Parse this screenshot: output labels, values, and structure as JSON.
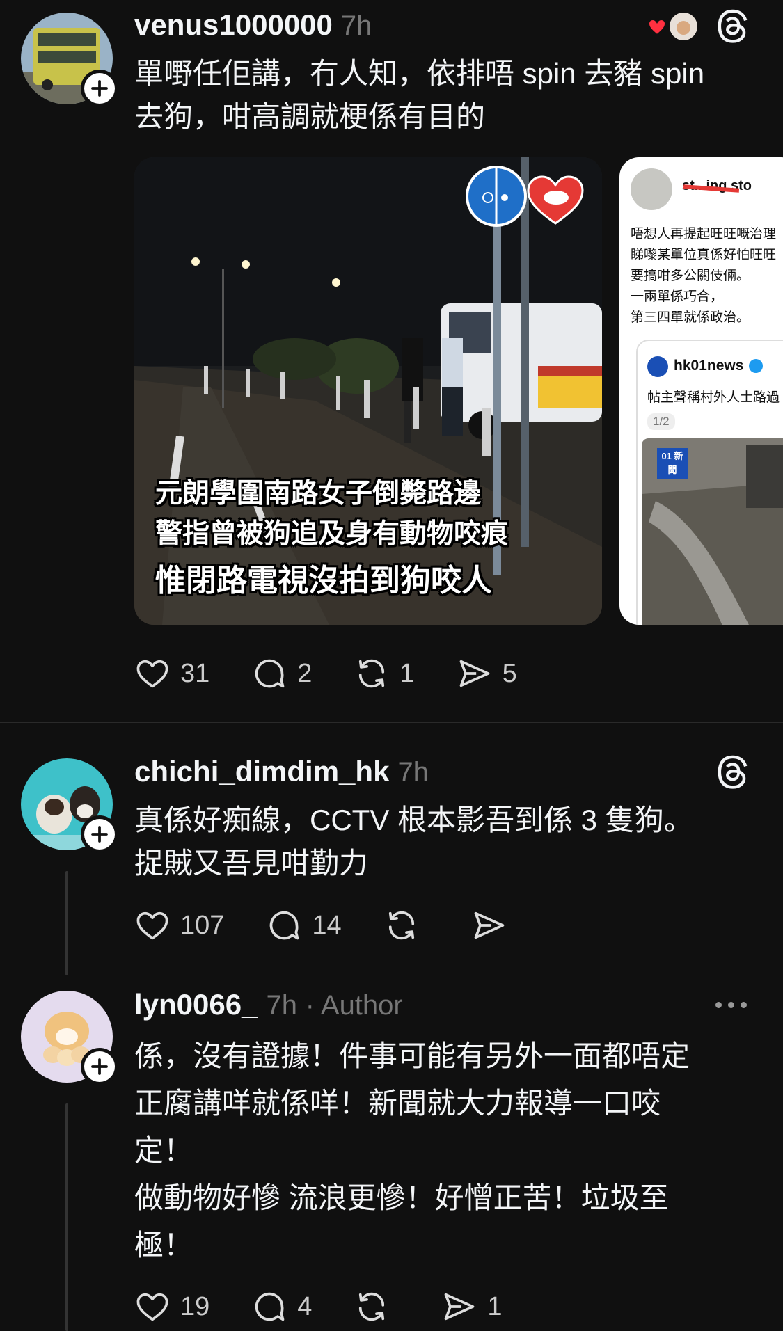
{
  "posts": [
    {
      "username": "venus1000000",
      "time": "7h",
      "text": "單嘢任佢講，冇人知，依排唔 spin 去豬 spin\n去狗，咁高調就梗係有目的",
      "media": {
        "image_captions": [
          "元朗學圍南路女子倒斃路邊",
          "警指曾被狗追及身有動物咬痕",
          "惟閉路電視沒拍到狗咬人"
        ],
        "card_header": "st...ing.sto",
        "card_lines": [
          "唔想人再提起旺旺嘅治理",
          "睇嚟某單位真係好怕旺旺",
          "要搞咁多公關伎倆。",
          "一兩單係巧合，",
          "第三四單就係政治。"
        ],
        "quoted_name": "hk01news",
        "quoted_text": "帖主聲稱村外人士路過",
        "quoted_counter": "1/2",
        "news_logo": "01 新聞"
      },
      "stats": {
        "likes": "31",
        "replies": "2",
        "reposts": "1",
        "shares": "5"
      }
    },
    {
      "username": "chichi_dimdim_hk",
      "time": "7h",
      "text": "真係好痴線，CCTV 根本影吾到係 3 隻狗。\n捉賊又吾見咁勤力",
      "stats": {
        "likes": "107",
        "replies": "14"
      }
    },
    {
      "username": "lyn0066_",
      "time": "7h",
      "author": "· Author",
      "text": "係，沒有證據！件事可能有另外一面都唔定\n正腐講咩就係咩！新聞就大力報導一口咬\n定！\n做動物好慘 流浪更慘！好憎正苦！垃圾至\n極！",
      "stats": {
        "likes": "19",
        "replies": "4",
        "shares": "1"
      }
    }
  ],
  "icons": [
    "heart-icon",
    "comment-icon",
    "repost-icon",
    "share-icon",
    "threads-logo-icon",
    "follow-plus-icon",
    "more-icon"
  ],
  "colors": {
    "background": "#101010",
    "text": "#f3f5f7",
    "muted": "#777777",
    "like_red": "#ff3040"
  }
}
